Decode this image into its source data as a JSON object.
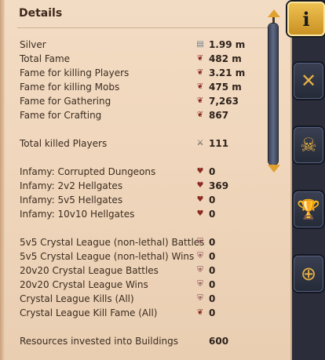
{
  "title": "Details",
  "stats_group1": [
    {
      "label": "Silver",
      "value": "1.99 m",
      "icon": "silver-icon"
    },
    {
      "label": "Total Fame",
      "value": "482 m",
      "icon": "fame-icon"
    },
    {
      "label": "Fame for killing Players",
      "value": "3.21 m",
      "icon": "fame-icon"
    },
    {
      "label": "Fame for killing Mobs",
      "value": "475 m",
      "icon": "fame-icon"
    },
    {
      "label": "Fame for Gathering",
      "value": "7,263",
      "icon": "fame-icon"
    },
    {
      "label": "Fame for Crafting",
      "value": "867",
      "icon": "fame-icon"
    }
  ],
  "stats_group2": [
    {
      "label": "Total killed Players",
      "value": "111",
      "icon": "crossed-swords-icon"
    }
  ],
  "stats_group3": [
    {
      "label": "Infamy: Corrupted Dungeons",
      "value": "0",
      "icon": "infamy-icon"
    },
    {
      "label": "Infamy: 2v2 Hellgates",
      "value": "369",
      "icon": "infamy-icon"
    },
    {
      "label": "Infamy: 5v5 Hellgates",
      "value": "0",
      "icon": "infamy-icon"
    },
    {
      "label": "Infamy: 10v10 Hellgates",
      "value": "0",
      "icon": "infamy-icon"
    }
  ],
  "stats_group4": [
    {
      "label": "5v5 Crystal League (non-lethal) Battles",
      "value": "0",
      "icon": "shield-icon"
    },
    {
      "label": "5v5 Crystal League (non-lethal) Wins",
      "value": "0",
      "icon": "shield-icon"
    },
    {
      "label": "20v20 Crystal League Battles",
      "value": "0",
      "icon": "shield-icon"
    },
    {
      "label": "20v20 Crystal League Wins",
      "value": "0",
      "icon": "shield-icon"
    },
    {
      "label": "Crystal League Kills (All)",
      "value": "0",
      "icon": "shield-icon"
    },
    {
      "label": "Crystal League Kill Fame (All)",
      "value": "0",
      "icon": "fame-icon"
    }
  ],
  "stats_group5": [
    {
      "label": "Resources invested into Buildings",
      "value": "600"
    }
  ],
  "tabs": [
    {
      "name": "info",
      "glyph": "i"
    },
    {
      "name": "combat",
      "glyph": "✕"
    },
    {
      "name": "pvp",
      "glyph": "☠"
    },
    {
      "name": "achievements",
      "glyph": "🏆"
    },
    {
      "name": "guild-war",
      "glyph": "⊕"
    }
  ],
  "colors": {
    "panel": "#f0d8be",
    "accent": "#e0a12e",
    "text": "#3b2c20"
  }
}
